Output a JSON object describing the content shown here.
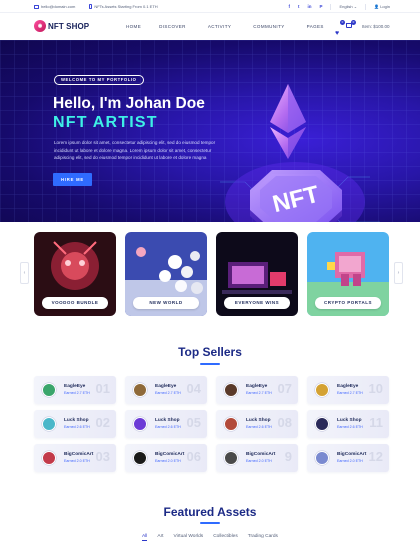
{
  "topbar": {
    "email": "hello@domain.com",
    "promo": "NFTs Assets Starting From 0.1 ETH",
    "social": [
      "f",
      "t",
      "in",
      "P"
    ],
    "language": "English",
    "login": "Login"
  },
  "nav": {
    "logo_text": "NFT SHOP",
    "menu": [
      "HOME",
      "DISCOVER",
      "ACTIVITY",
      "COMMUNITY",
      "PAGES"
    ],
    "wishlist_count": "0",
    "cart_count": "0",
    "cart_total": "Item: $100.00"
  },
  "hero": {
    "pill": "WELCOME TO MY PORTFOLIO",
    "heading": "Hello, I'm Johan Doe",
    "subheading": "NFT ARTIST",
    "paragraph": "Lorem ipsum dolor sit amet, consectetur adipiscing elit, sed do eiusmod tempor incididunt ut labore et dolore magna. Lorem ipsum dolor sit amet, consectetur adipiscing elit, sed do eiusmod tempor incididunt ut labore et dolore magna",
    "button": "HIRE ME",
    "art_text": "NFT"
  },
  "carousel": {
    "prev": "‹",
    "next": "›",
    "cards": [
      {
        "label": "VOODOO BUNDLE",
        "colors": [
          "#2b0d14",
          "#b2324a"
        ]
      },
      {
        "label": "NEW WORLD",
        "colors": [
          "#2f3f9a",
          "#d6cfe8"
        ]
      },
      {
        "label": "EVERYONE WINS",
        "colors": [
          "#0d0a1a",
          "#6b2a8e"
        ]
      },
      {
        "label": "CRYPTO PORTALS",
        "colors": [
          "#4fb3f0",
          "#e3a6cf"
        ]
      }
    ]
  },
  "top_sellers": {
    "title": "Top Sellers",
    "sellers": [
      {
        "name": "EagleEye",
        "earned": "Earned 2.7 ETH",
        "no": "01",
        "avatar": "#3aa56b"
      },
      {
        "name": "EagleEye",
        "earned": "Earned 2.7 ETH",
        "no": "04",
        "avatar": "#8f6a3a"
      },
      {
        "name": "EagleEye",
        "earned": "Earned 2.7 ETH",
        "no": "07",
        "avatar": "#5a3a2a"
      },
      {
        "name": "EagleEye",
        "earned": "Earned 2.7 ETH",
        "no": "10",
        "avatar": "#d4a233"
      },
      {
        "name": "Luck Shop",
        "earned": "Earned 2.6 ETH",
        "no": "02",
        "avatar": "#4ab7c9"
      },
      {
        "name": "Luck Shop",
        "earned": "Earned 2.6 ETH",
        "no": "05",
        "avatar": "#6c3bd6"
      },
      {
        "name": "Luck Shop",
        "earned": "Earned 2.6 ETH",
        "no": "08",
        "avatar": "#b24a3a"
      },
      {
        "name": "Luck Shop",
        "earned": "Earned 2.6 ETH",
        "no": "11",
        "avatar": "#2a2a5a"
      },
      {
        "name": "BigComicArt",
        "earned": "Earned 2.0 ETH",
        "no": "03",
        "avatar": "#c23a4a"
      },
      {
        "name": "BigComicArt",
        "earned": "Earned 2.0 ETH",
        "no": "06",
        "avatar": "#1a1a1a"
      },
      {
        "name": "BigComicArt",
        "earned": "Earned 2.0 ETH",
        "no": "9",
        "avatar": "#4a4a4a"
      },
      {
        "name": "BigComicArt",
        "earned": "Earned 2.0 ETH",
        "no": "12",
        "avatar": "#7a8ad0"
      }
    ]
  },
  "featured": {
    "title": "Featured Assets",
    "tabs": [
      "All",
      "Art",
      "Virtual Worlds",
      "Collectibles",
      "Trading Cards"
    ]
  }
}
